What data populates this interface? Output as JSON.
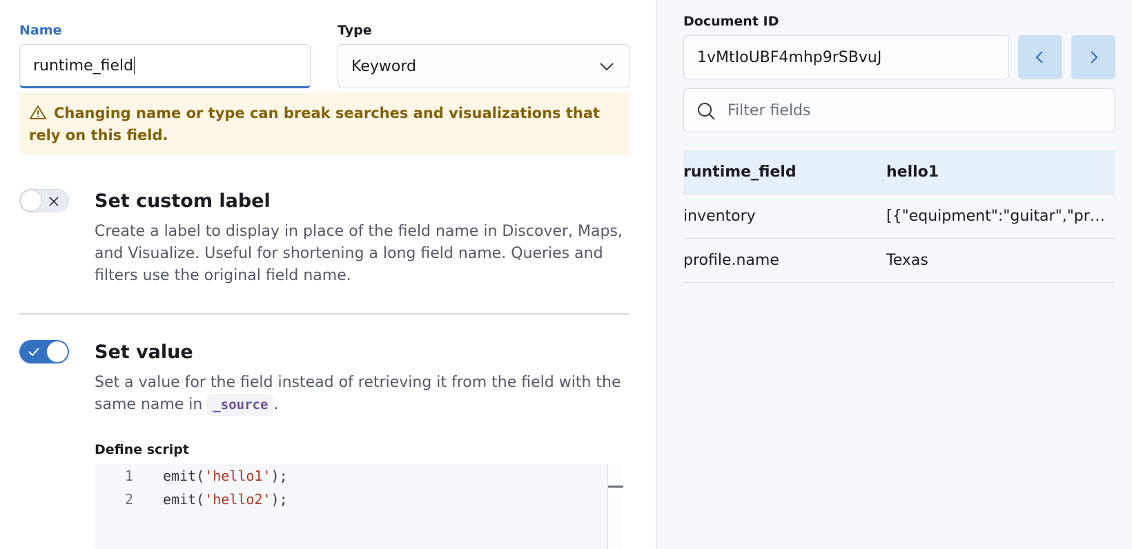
{
  "form": {
    "name_label": "Name",
    "name_value": "runtime_field",
    "type_label": "Type",
    "type_value": "Keyword",
    "warning": "Changing name or type can break searches and visualizations that rely on this field."
  },
  "custom_label": {
    "title": "Set custom label",
    "description": "Create a label to display in place of the field name in Discover, Maps, and Visualize. Useful for shortening a long field name. Queries and filters use the original field name.",
    "enabled": false
  },
  "set_value": {
    "title": "Set value",
    "description_prefix": "Set a value for the field instead of retrieving it from the field with the same name in",
    "source_code": "_source",
    "description_suffix": ".",
    "enabled": true,
    "script_label": "Define script",
    "script_lines": [
      {
        "num": "1",
        "fn": "emit(",
        "str": "'hello1'",
        "end": ");"
      },
      {
        "num": "2",
        "fn": "emit(",
        "str": "'hello2'",
        "end": ");"
      }
    ]
  },
  "preview": {
    "doc_id_label": "Document ID",
    "doc_id_value": "1vMtIoUBF4mhp9rSBvuJ",
    "filter_placeholder": "Filter fields",
    "rows": [
      {
        "key": "runtime_field",
        "value": "hello1"
      },
      {
        "key": "inventory",
        "value": "[{\"equipment\":\"guitar\",\"pri..."
      },
      {
        "key": "profile.name",
        "value": "Texas"
      }
    ]
  },
  "colors": {
    "primary": "#3571c2",
    "warning_bg": "#fef6e6",
    "warning_text": "#82620a",
    "string": "#b0341f"
  }
}
